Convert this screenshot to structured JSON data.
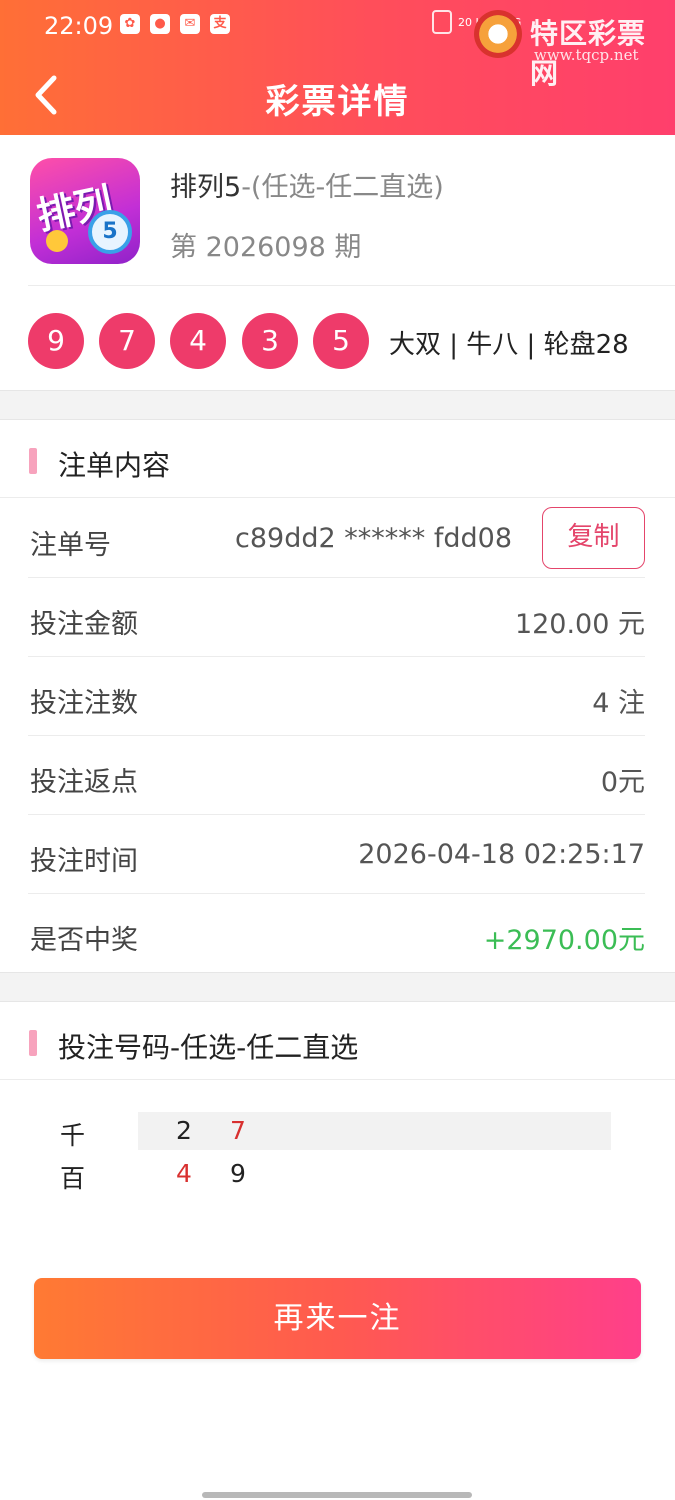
{
  "status_bar": {
    "time": "22:09",
    "notif_icons": [
      "taobao-icon",
      "wechat-icon",
      "mail-icon",
      "alipay-icon"
    ],
    "small_text": "20 KB/s",
    "network": "5G"
  },
  "watermark": {
    "name": "特区彩票网",
    "url": "www.tqcp.net"
  },
  "header": {
    "title": "彩票详情"
  },
  "lottery": {
    "name": "排列5",
    "play": "-(任选-任二直选)",
    "issue": "第 2026098 期",
    "logo_text": "排列",
    "logo_ball": "5"
  },
  "draw": {
    "balls": [
      "9",
      "7",
      "4",
      "3",
      "5"
    ],
    "info": "大双 | 牛八 | 轮盘28",
    "ball_color": "#ee3b6a"
  },
  "order_section": {
    "title": "注单内容",
    "rows": [
      {
        "label": "注单号",
        "value": "c89dd2 ****** fdd08"
      },
      {
        "label": "投注金额",
        "value": "120.00 元"
      },
      {
        "label": "投注注数",
        "value": "4 注"
      },
      {
        "label": "投注返点",
        "value": "0元"
      },
      {
        "label": "投注时间",
        "value": "2026-04-18 02:25:17"
      },
      {
        "label": "是否中奖",
        "value": "+2970.00元"
      }
    ],
    "copy_label": "复制"
  },
  "bet_section": {
    "title": "投注号码-任选-任二直选",
    "rows": [
      {
        "position": "千",
        "numbers": [
          "2",
          "7"
        ],
        "highlight": [
          "7"
        ]
      },
      {
        "position": "百",
        "numbers": [
          "4",
          "9"
        ],
        "highlight": [
          "4"
        ]
      }
    ]
  },
  "again_button": "再来一注",
  "colors": {
    "header_start": "#ff6f36",
    "header_end": "#ff3f6c",
    "win_green": "#3bbd55",
    "accent_pink": "#e4456b"
  }
}
